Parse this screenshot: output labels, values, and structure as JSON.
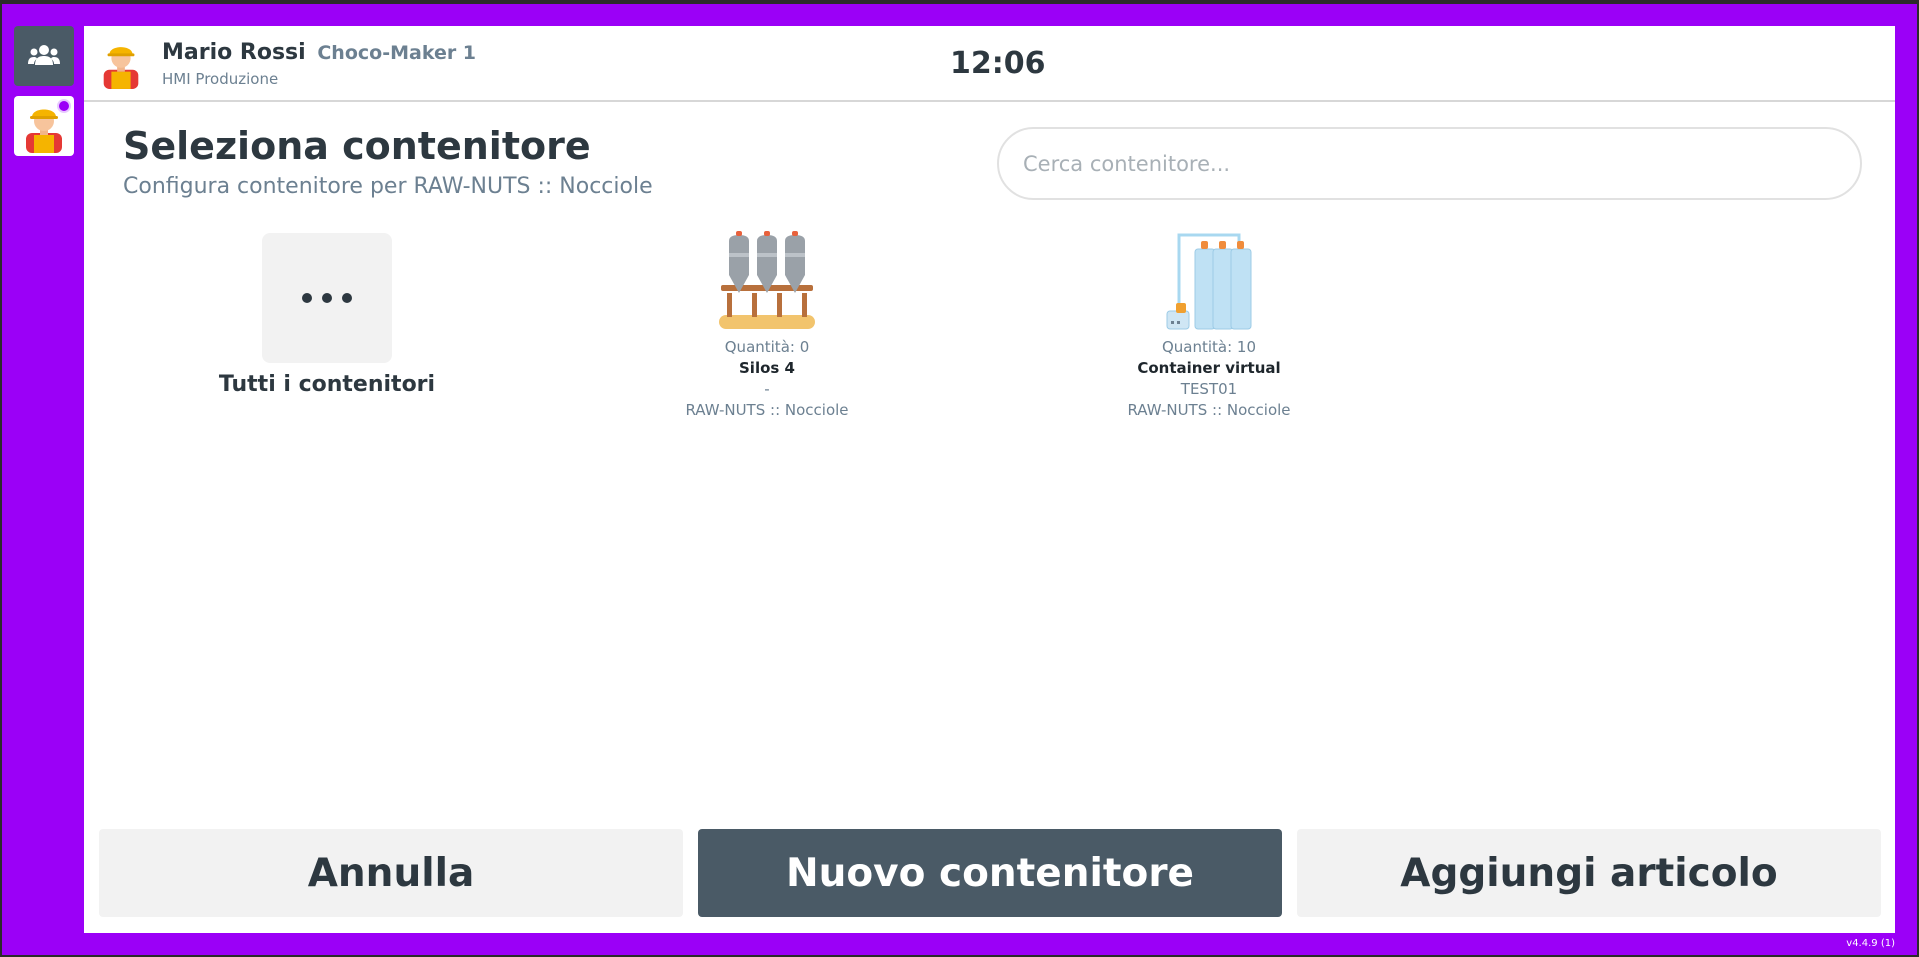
{
  "user": {
    "name": "Mario Rossi",
    "machine": "Choco-Maker 1",
    "app": "HMI Produzione"
  },
  "clock": "12:06",
  "page": {
    "title": "Seleziona contenitore",
    "subtitle": "Configura contenitore per RAW-NUTS :: Nocciole"
  },
  "search": {
    "placeholder": "Cerca contenitore..."
  },
  "all_tile": {
    "label": "Tutti i contenitori",
    "icon": "more-dots-icon"
  },
  "containers": [
    {
      "quantity": "Quantità: 0",
      "name": "Silos 4",
      "code": "-",
      "material": "RAW-NUTS :: Nocciole",
      "icon": "silos-icon"
    },
    {
      "quantity": "Quantità: 10",
      "name": "Container virtual",
      "code": "TEST01",
      "material": "RAW-NUTS :: Nocciole",
      "icon": "tanks-icon"
    }
  ],
  "buttons": {
    "cancel": "Annulla",
    "new": "Nuovo contenitore",
    "add": "Aggiungi articolo"
  },
  "version": "v4.4.9 (1)",
  "colors": {
    "frame": "#9b00f7",
    "dark": "#4a5a66",
    "text": "#2d3840",
    "muted": "#6c8091"
  }
}
